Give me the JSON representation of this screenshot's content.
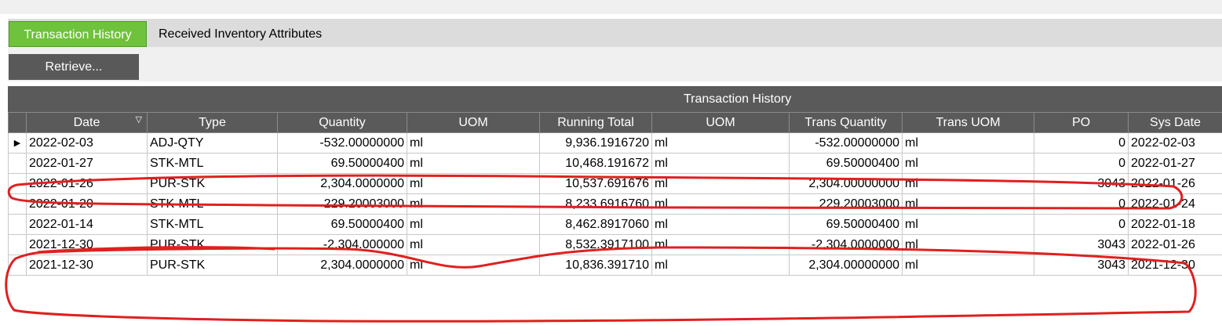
{
  "tabs": {
    "active_label": "Transaction History",
    "inactive_label": "Received Inventory Attributes"
  },
  "toolbar": {
    "retrieve_label": "Retrieve..."
  },
  "grid": {
    "group_title": "Transaction History",
    "columns": [
      "Date",
      "Type",
      "Quantity",
      "UOM",
      "Running Total",
      "UOM",
      "Trans Quantity",
      "Trans UOM",
      "PO",
      "Sys Date"
    ],
    "rows": [
      [
        "2022-02-03",
        "ADJ-QTY",
        "-532.00000000",
        "ml",
        "9,936.1916720",
        "ml",
        "-532.00000000",
        "ml",
        "0",
        "2022-02-03"
      ],
      [
        "2022-01-27",
        "STK-MTL",
        "69.50000400",
        "ml",
        "10,468.191672",
        "ml",
        "69.50000400",
        "ml",
        "0",
        "2022-01-27"
      ],
      [
        "2022-01-26",
        "PUR-STK",
        "2,304.0000000",
        "ml",
        "10,537.691676",
        "ml",
        "2,304.00000000",
        "ml",
        "3043",
        "2022-01-26"
      ],
      [
        "2022-01-20",
        "STK-MTL",
        "229.20003000",
        "ml",
        "8,233.6916760",
        "ml",
        "229.20003000",
        "ml",
        "0",
        "2022-01-24"
      ],
      [
        "2022-01-14",
        "STK-MTL",
        "69.50000400",
        "ml",
        "8,462.8917060",
        "ml",
        "69.50000400",
        "ml",
        "0",
        "2022-01-18"
      ],
      [
        "2021-12-30",
        "PUR-STK",
        "-2,304.000000",
        "ml",
        "8,532.3917100",
        "ml",
        "-2,304.0000000",
        "ml",
        "3043",
        "2022-01-26"
      ],
      [
        "2021-12-30",
        "PUR-STK",
        "2,304.0000000",
        "ml",
        "10,836.391710",
        "ml",
        "2,304.00000000",
        "ml",
        "3043",
        "2021-12-30"
      ]
    ]
  },
  "colors": {
    "active_tab": "#6fc23b",
    "header_bg": "#5a5a5a",
    "annotation": "#e02020"
  }
}
